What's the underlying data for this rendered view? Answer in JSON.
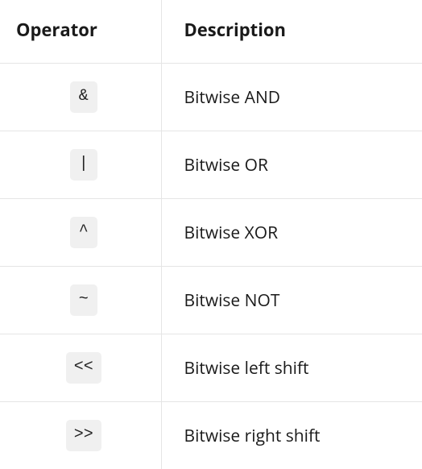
{
  "table": {
    "headers": {
      "operator": "Operator",
      "description": "Description"
    },
    "rows": [
      {
        "operator": "&",
        "description": "Bitwise AND"
      },
      {
        "operator": "|",
        "description": "Bitwise OR"
      },
      {
        "operator": "^",
        "description": "Bitwise XOR"
      },
      {
        "operator": "~",
        "description": "Bitwise NOT"
      },
      {
        "operator": "<<",
        "description": "Bitwise left shift"
      },
      {
        "operator": ">>",
        "description": "Bitwise right shift"
      }
    ]
  }
}
